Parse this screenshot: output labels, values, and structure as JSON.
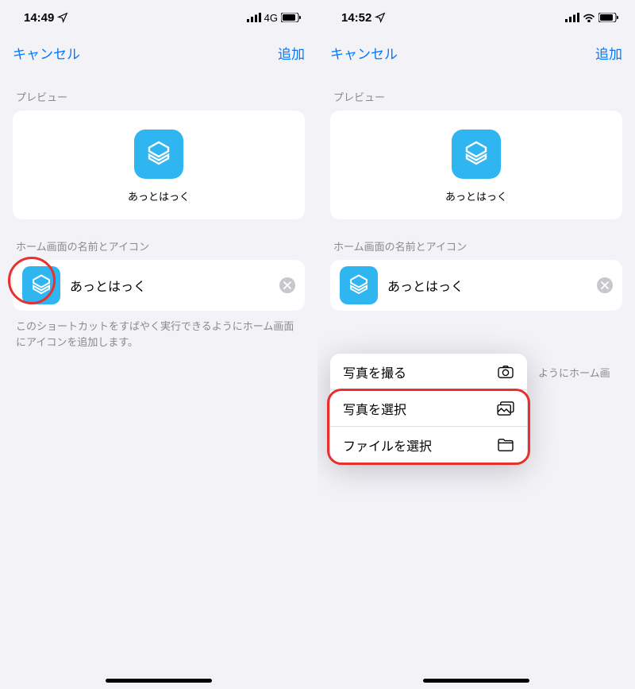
{
  "left": {
    "time": "14:49",
    "network": "4G",
    "cancel": "キャンセル",
    "add": "追加",
    "previewLabel": "プレビュー",
    "previewName": "あっとはっく",
    "iconSectionLabel": "ホーム画面の名前とアイコン",
    "inputValue": "あっとはっく",
    "hint": "このショートカットをすばやく実行できるようにホーム画面にアイコンを追加します。"
  },
  "right": {
    "time": "14:52",
    "cancel": "キャンセル",
    "add": "追加",
    "previewLabel": "プレビュー",
    "previewName": "あっとはっく",
    "iconSectionLabel": "ホーム画面の名前とアイコン",
    "inputValue": "あっとはっく",
    "hintPartial": "ようにホーム画",
    "menu": {
      "takePhoto": "写真を撮る",
      "choosePhoto": "写真を選択",
      "chooseFile": "ファイルを選択"
    }
  }
}
